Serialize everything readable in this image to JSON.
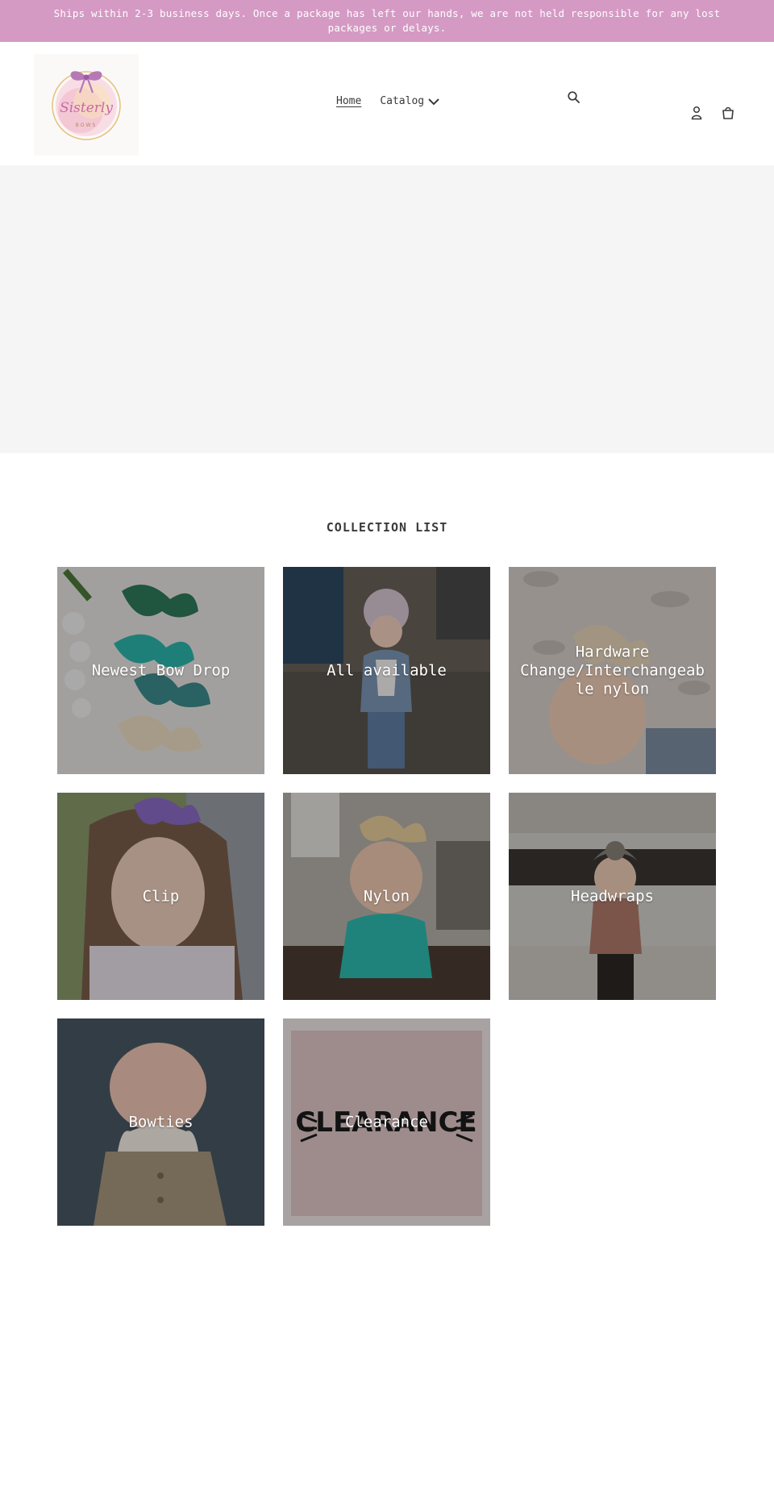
{
  "announcement": {
    "text": "Ships within 2-3 business days. Once a package has left our hands, we are not held responsible for any lost packages or delays."
  },
  "header": {
    "logo_icon": "sisterly-bows-logo",
    "logo_text": "Sisterly",
    "logo_subtext": "BOWS",
    "nav": {
      "home": "Home",
      "catalog": "Catalog"
    },
    "icons": {
      "search": "search-icon",
      "account": "account-icon",
      "cart": "cart-icon"
    }
  },
  "colors": {
    "announcement_bg": "#d49ac4",
    "hero_bg": "#f5f5f5",
    "text": "#3a3a3a"
  },
  "collection_list": {
    "title": "COLLECTION LIST",
    "items": [
      {
        "label": "Newest Bow Drop"
      },
      {
        "label": "All available"
      },
      {
        "label": "Hardware Change/Interchangeab le nylon"
      },
      {
        "label": "Clip"
      },
      {
        "label": "Nylon"
      },
      {
        "label": "Headwraps"
      },
      {
        "label": "Bowties"
      },
      {
        "label": "Clearance",
        "image_text": "CLEARANCE"
      }
    ]
  }
}
